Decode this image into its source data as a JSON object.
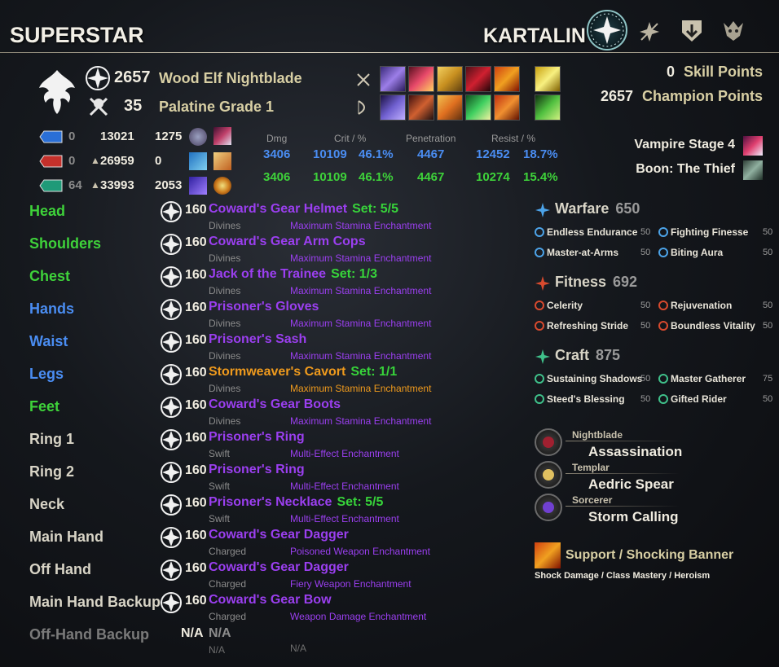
{
  "header": {
    "account": "SUPERSTAR",
    "character": "KARTALIN"
  },
  "character": {
    "cp_level": "2657",
    "race_class": "Wood Elf Nightblade",
    "level": "35",
    "grade": "Palatine Grade 1"
  },
  "points": {
    "skill_points": "0",
    "skill_points_label": "Skill Points",
    "champion_points": "2657",
    "champion_points_label": "Champion Points"
  },
  "resources": [
    {
      "color": "#2a6fd6",
      "regen": "0",
      "max": "13021",
      "value3": "1275",
      "arrow": ""
    },
    {
      "color": "#c4302b",
      "regen": "0",
      "max": "26959",
      "value3": "0",
      "arrow": "▲"
    },
    {
      "color": "#1f9a78",
      "regen": "64",
      "max": "33993",
      "value3": "2053",
      "arrow": "▲"
    }
  ],
  "stats": {
    "headers": {
      "dmg": "Dmg",
      "crit": "Crit / %",
      "pen": "Penetration",
      "resist": "Resist / %"
    },
    "rows": [
      {
        "dmg": "3406",
        "crit": "10109",
        "crit_pct": "46.1%",
        "pen": "4467",
        "resist": "12452",
        "resist_pct": "18.7%"
      },
      {
        "dmg": "3406",
        "crit": "10109",
        "crit_pct": "46.1%",
        "pen": "4467",
        "resist": "10274",
        "resist_pct": "15.4%"
      }
    ]
  },
  "status": {
    "vampire": "Vampire Stage 4",
    "boon": "Boon: The Thief"
  },
  "gear": [
    {
      "slot": "Head",
      "slot_color": "green",
      "level": "160",
      "item": "Coward's Gear Helmet",
      "set": "Set: 5/5",
      "trait": "Divines",
      "ench": "Maximum Stamina Enchantment",
      "quality": "epic"
    },
    {
      "slot": "Shoulders",
      "slot_color": "green",
      "level": "160",
      "item": "Coward's Gear Arm Cops",
      "set": "",
      "trait": "Divines",
      "ench": "Maximum Stamina Enchantment",
      "quality": "epic"
    },
    {
      "slot": "Chest",
      "slot_color": "green",
      "level": "160",
      "item": "Jack of the Trainee",
      "set": "Set: 1/3",
      "trait": "Divines",
      "ench": "Maximum Stamina Enchantment",
      "quality": "epic"
    },
    {
      "slot": "Hands",
      "slot_color": "blue",
      "level": "160",
      "item": "Prisoner's Gloves",
      "set": "",
      "trait": "Divines",
      "ench": "Maximum Stamina Enchantment",
      "quality": "epic"
    },
    {
      "slot": "Waist",
      "slot_color": "blue",
      "level": "160",
      "item": "Prisoner's Sash",
      "set": "",
      "trait": "Divines",
      "ench": "Maximum Stamina Enchantment",
      "quality": "epic"
    },
    {
      "slot": "Legs",
      "slot_color": "blue",
      "level": "160",
      "item": "Stormweaver's Cavort",
      "set": "Set: 1/1",
      "trait": "Divines",
      "ench": "Maximum Stamina Enchantment",
      "quality": "legendary"
    },
    {
      "slot": "Feet",
      "slot_color": "green",
      "level": "160",
      "item": "Coward's Gear Boots",
      "set": "",
      "trait": "Divines",
      "ench": "Maximum Stamina Enchantment",
      "quality": "epic"
    },
    {
      "slot": "Ring 1",
      "slot_color": "white",
      "level": "160",
      "item": "Prisoner's Ring",
      "set": "",
      "trait": "Swift",
      "ench": "Multi-Effect Enchantment",
      "quality": "epic"
    },
    {
      "slot": "Ring 2",
      "slot_color": "white",
      "level": "160",
      "item": "Prisoner's Ring",
      "set": "",
      "trait": "Swift",
      "ench": "Multi-Effect Enchantment",
      "quality": "epic"
    },
    {
      "slot": "Neck",
      "slot_color": "white",
      "level": "160",
      "item": "Prisoner's Necklace",
      "set": "Set: 5/5",
      "trait": "Swift",
      "ench": "Multi-Effect Enchantment",
      "quality": "epic"
    },
    {
      "slot": "Main Hand",
      "slot_color": "white",
      "level": "160",
      "item": "Coward's Gear Dagger",
      "set": "",
      "trait": "Charged",
      "ench": "Poisoned Weapon Enchantment",
      "quality": "epic"
    },
    {
      "slot": "Off Hand",
      "slot_color": "white",
      "level": "160",
      "item": "Coward's Gear Dagger",
      "set": "",
      "trait": "Charged",
      "ench": "Fiery Weapon Enchantment",
      "quality": "epic"
    },
    {
      "slot": "Main Hand Backup",
      "slot_color": "white",
      "level": "160",
      "item": "Coward's Gear Bow",
      "set": "",
      "trait": "Charged",
      "ench": "Weapon Damage Enchantment",
      "quality": "epic"
    }
  ],
  "offhand_backup": {
    "slot": "Off-Hand Backup",
    "level": "N/A",
    "item": "N/A",
    "trait": "N/A",
    "ench": "N/A"
  },
  "champion": [
    {
      "name": "Warfare",
      "value": "650",
      "color": "#4ca3e8",
      "stars": [
        {
          "name": "Endless Endurance",
          "pts": "50"
        },
        {
          "name": "Fighting Finesse",
          "pts": "50"
        },
        {
          "name": "Master-at-Arms",
          "pts": "50"
        },
        {
          "name": "Biting Aura",
          "pts": "50"
        }
      ]
    },
    {
      "name": "Fitness",
      "value": "692",
      "color": "#d84a2e",
      "stars": [
        {
          "name": "Celerity",
          "pts": "50"
        },
        {
          "name": "Rejuvenation",
          "pts": "50"
        },
        {
          "name": "Refreshing Stride",
          "pts": "50"
        },
        {
          "name": "Boundless Vitality",
          "pts": "50"
        }
      ]
    },
    {
      "name": "Craft",
      "value": "875",
      "color": "#3fc08a",
      "stars": [
        {
          "name": "Sustaining Shadows",
          "pts": "50"
        },
        {
          "name": "Master Gatherer",
          "pts": "75"
        },
        {
          "name": "Steed's Blessing",
          "pts": "50"
        },
        {
          "name": "Gifted Rider",
          "pts": "50"
        }
      ]
    }
  ],
  "skill_lines": [
    {
      "class": "Nightblade",
      "line": "Assassination"
    },
    {
      "class": "Templar",
      "line": "Aedric Spear"
    },
    {
      "class": "Sorcerer",
      "line": "Storm Calling"
    }
  ],
  "subclass": {
    "title": "Support / Shocking Banner",
    "desc": "Shock Damage / Class Mastery / Heroism"
  }
}
